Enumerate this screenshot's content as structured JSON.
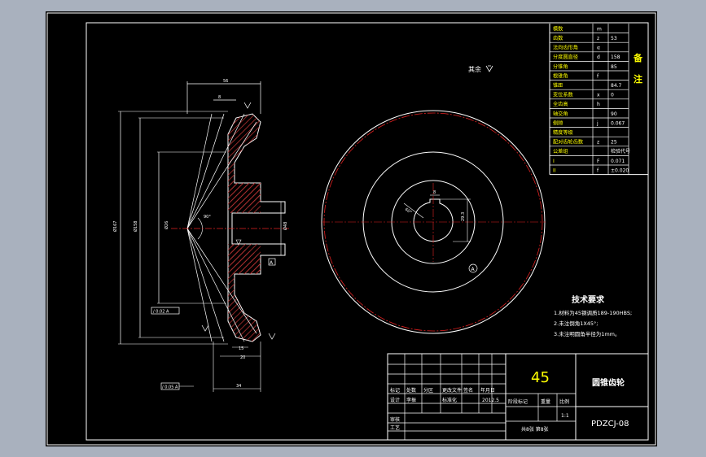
{
  "colors": {
    "viewport_bg": "#a9b1be",
    "sheet_bg": "#000000",
    "line_white": "#ffffff",
    "hatch_red": "#b03030",
    "center_red": "#e02020",
    "text_yellow": "#ffff00",
    "dim_white": "#e8e8e8"
  },
  "param_table": {
    "rows": [
      {
        "label": "模数",
        "sym": "m",
        "val": ""
      },
      {
        "label": "齿数",
        "sym": "z",
        "val": "53"
      },
      {
        "label": "法向齿形角",
        "sym": "α",
        "val": ""
      },
      {
        "label": "分度圆直径",
        "sym": "d",
        "val": "158"
      },
      {
        "label": "分锥角",
        "sym": "",
        "val": "85"
      },
      {
        "label": "根锥角",
        "sym": "f",
        "val": ""
      },
      {
        "label": "锥距",
        "sym": "",
        "val": "84.7"
      },
      {
        "label": "变位系数",
        "sym": "x",
        "val": "0"
      },
      {
        "label": "全齿高",
        "sym": "h",
        "val": ""
      },
      {
        "label": "轴交角",
        "sym": "",
        "val": "90"
      },
      {
        "label": "侧隙",
        "sym": "j",
        "val": "0.067"
      },
      {
        "label": "精度等级",
        "sym": "",
        "val": ""
      },
      {
        "label": "配对齿轮齿数",
        "sym": "z",
        "val": "25"
      },
      {
        "label": "公差组",
        "sym": "",
        "val": "检验代号"
      },
      {
        "label": "I",
        "sym": "F",
        "val": "0.071"
      },
      {
        "label": "II",
        "sym": "f",
        "val": "±0.020"
      }
    ],
    "remark": [
      "备",
      "注"
    ]
  },
  "surface_note": "其余",
  "section_labels": {
    "left_tol": "/ 0.02 A",
    "bottom_tol": "/ 0.05 A",
    "datum": "A"
  },
  "dims": {
    "top": "56",
    "top2": "8",
    "d1": "Ø167",
    "d2": "Ø158",
    "d3": "Ø26",
    "d4": "Ø48",
    "angle": "90°",
    "b1": "15",
    "b2": "20",
    "b3": "34",
    "face_angle": "60°",
    "key": "8",
    "bore": "29.3"
  },
  "tech_req": {
    "title": "技术要求",
    "items": [
      "1.材料为45钢调质189-190HBS;",
      "2.未注倒角1X45°;",
      "3.未注明圆角半径为1mm。"
    ]
  },
  "title_block": {
    "material": "45",
    "part_name": "圆锥齿轮",
    "drawing_no": "PDZCJ-08",
    "rev_headers": [
      "标记",
      "处数",
      "分区",
      "更改文件",
      "签名",
      "年月日"
    ],
    "design_row": [
      "设计",
      "李振",
      "",
      "标准化",
      "",
      "2012.5"
    ],
    "review": "审核",
    "process": "工艺",
    "stage_headers": [
      "阶段标记",
      "重量",
      "比例"
    ],
    "scale": "1:1",
    "sheets": "共8张 第8张"
  }
}
